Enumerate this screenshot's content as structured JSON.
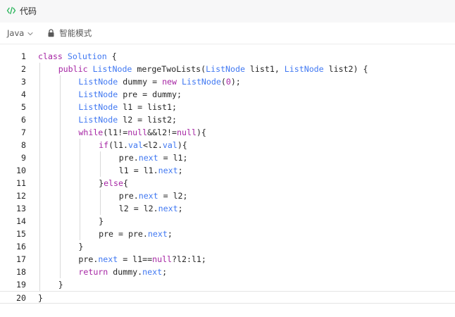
{
  "header": {
    "title": "代码",
    "icon": "code-icon"
  },
  "toolbar": {
    "language": "Java",
    "mode_label": "智能模式"
  },
  "editor": {
    "current_line": 20,
    "lines": [
      {
        "n": "1",
        "indent": 0,
        "tokens": [
          [
            "kw",
            "class"
          ],
          [
            "p",
            " "
          ],
          [
            "ty",
            "Solution"
          ],
          [
            "p",
            " {"
          ]
        ]
      },
      {
        "n": "2",
        "indent": 1,
        "tokens": [
          [
            "kw",
            "public"
          ],
          [
            "p",
            " "
          ],
          [
            "ty",
            "ListNode"
          ],
          [
            "p",
            " mergeTwoLists("
          ],
          [
            "ty",
            "ListNode"
          ],
          [
            "p",
            " list1, "
          ],
          [
            "ty",
            "ListNode"
          ],
          [
            "p",
            " list2) {"
          ]
        ]
      },
      {
        "n": "3",
        "indent": 2,
        "tokens": [
          [
            "ty",
            "ListNode"
          ],
          [
            "p",
            " dummy = "
          ],
          [
            "kw",
            "new"
          ],
          [
            "p",
            " "
          ],
          [
            "ty",
            "ListNode"
          ],
          [
            "p",
            "("
          ],
          [
            "num",
            "0"
          ],
          [
            "p",
            ");"
          ]
        ]
      },
      {
        "n": "4",
        "indent": 2,
        "tokens": [
          [
            "ty",
            "ListNode"
          ],
          [
            "p",
            " pre = dummy;"
          ]
        ]
      },
      {
        "n": "5",
        "indent": 2,
        "tokens": [
          [
            "ty",
            "ListNode"
          ],
          [
            "p",
            " l1 = list1;"
          ]
        ]
      },
      {
        "n": "6",
        "indent": 2,
        "tokens": [
          [
            "ty",
            "ListNode"
          ],
          [
            "p",
            " l2 = list2;"
          ]
        ]
      },
      {
        "n": "7",
        "indent": 2,
        "tokens": [
          [
            "kw",
            "while"
          ],
          [
            "p",
            "(l1!="
          ],
          [
            "kw",
            "null"
          ],
          [
            "p",
            "&&l2!="
          ],
          [
            "kw",
            "null"
          ],
          [
            "p",
            "){"
          ]
        ]
      },
      {
        "n": "8",
        "indent": 3,
        "tokens": [
          [
            "kw",
            "if"
          ],
          [
            "p",
            "(l1."
          ],
          [
            "ty",
            "val"
          ],
          [
            "p",
            "<l2."
          ],
          [
            "ty",
            "val"
          ],
          [
            "p",
            "){"
          ]
        ]
      },
      {
        "n": "9",
        "indent": 4,
        "tokens": [
          [
            "p",
            "pre."
          ],
          [
            "ty",
            "next"
          ],
          [
            "p",
            " = l1;"
          ]
        ]
      },
      {
        "n": "10",
        "indent": 4,
        "tokens": [
          [
            "p",
            "l1 = l1."
          ],
          [
            "ty",
            "next"
          ],
          [
            "p",
            ";"
          ]
        ]
      },
      {
        "n": "11",
        "indent": 3,
        "tokens": [
          [
            "p",
            "}"
          ],
          [
            "kw",
            "else"
          ],
          [
            "p",
            "{"
          ]
        ]
      },
      {
        "n": "12",
        "indent": 4,
        "tokens": [
          [
            "p",
            "pre."
          ],
          [
            "ty",
            "next"
          ],
          [
            "p",
            " = l2;"
          ]
        ]
      },
      {
        "n": "13",
        "indent": 4,
        "tokens": [
          [
            "p",
            "l2 = l2."
          ],
          [
            "ty",
            "next"
          ],
          [
            "p",
            ";"
          ]
        ]
      },
      {
        "n": "14",
        "indent": 3,
        "tokens": [
          [
            "p",
            "}"
          ]
        ]
      },
      {
        "n": "15",
        "indent": 3,
        "tokens": [
          [
            "p",
            "pre = pre."
          ],
          [
            "ty",
            "next"
          ],
          [
            "p",
            ";"
          ]
        ]
      },
      {
        "n": "16",
        "indent": 2,
        "tokens": [
          [
            "p",
            "}"
          ]
        ]
      },
      {
        "n": "17",
        "indent": 2,
        "tokens": [
          [
            "p",
            "pre."
          ],
          [
            "ty",
            "next"
          ],
          [
            "p",
            " = l1=="
          ],
          [
            "kw",
            "null"
          ],
          [
            "p",
            "?l2:l1;"
          ]
        ]
      },
      {
        "n": "18",
        "indent": 2,
        "tokens": [
          [
            "kw",
            "return"
          ],
          [
            "p",
            " dummy."
          ],
          [
            "ty",
            "next"
          ],
          [
            "p",
            ";"
          ]
        ]
      },
      {
        "n": "19",
        "indent": 1,
        "tokens": [
          [
            "p",
            "}"
          ]
        ]
      },
      {
        "n": "20",
        "indent": 0,
        "tokens": [
          [
            "p",
            "}"
          ]
        ]
      }
    ]
  },
  "colors": {
    "keyword": "#a626a4",
    "type": "#4078f2",
    "text": "#262626",
    "accent": "#2db55d"
  }
}
